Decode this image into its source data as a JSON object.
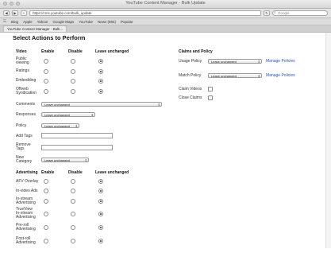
{
  "window": {
    "title": "YouTube Content Manager - Bulk Update",
    "url": "https://cms.youtube.com/bulk_update",
    "search_placeholder": "Google"
  },
  "bookmarks": [
    "Bing",
    "Apple",
    "Yahoo!",
    "Google Maps",
    "YouTube",
    "News (894)",
    "Popular"
  ],
  "tab": {
    "label": "YouTube Content Manager - Bulk..."
  },
  "page": {
    "heading": "Select Actions to Perform"
  },
  "video": {
    "headers": {
      "section": "Video",
      "enable": "Enable",
      "disable": "Disable",
      "unchanged": "Leave unchanged"
    },
    "rows": [
      {
        "label1": "Public",
        "label2": "viewing",
        "state": "unchanged"
      },
      {
        "label1": "Ratings",
        "label2": "",
        "state": "unchanged"
      },
      {
        "label1": "Embedding",
        "label2": "",
        "state": "unchanged"
      },
      {
        "label1": "Offweb",
        "label2": "Syndication",
        "state": "unchanged"
      }
    ]
  },
  "fields": {
    "comments": {
      "label": "Comments",
      "value": "Leave unchanged"
    },
    "responses": {
      "label": "Responses",
      "value": "Leave unchanged"
    },
    "policy": {
      "label": "Policy",
      "value": "Leave unchanged"
    },
    "add_tags": {
      "label": "Add Tags",
      "value": ""
    },
    "remove_tags": {
      "label1": "Remove",
      "label2": "Tags",
      "value": ""
    },
    "new_category": {
      "label1": "New",
      "label2": "Category",
      "value": "Leave unchanged"
    }
  },
  "claims": {
    "heading": "Claims and Policy",
    "usage_policy": {
      "label": "Usage Policy",
      "value": "Leave unchanged",
      "link": "Manage Policies"
    },
    "match_policy": {
      "label": "Match Policy",
      "value": "Leave unchanged",
      "link": "Manage Policies"
    },
    "claim_videos": {
      "label": "Claim Videos"
    },
    "close_claims": {
      "label": "Close Claims"
    }
  },
  "advertising": {
    "headers": {
      "section": "Advertising",
      "enable": "Enable",
      "disable": "Disable",
      "unchanged": "Leave unchanged"
    },
    "rows": [
      {
        "label1": "AFV Overlay",
        "label2": "",
        "state": "unchanged"
      },
      {
        "label1": "In-video Ads",
        "label2": "",
        "state": "unchanged"
      },
      {
        "label1": "In-stream",
        "label2": "Advertising",
        "state": "unchanged"
      },
      {
        "label1": "TrueView",
        "label2": "In-stream Advertising",
        "state": "unchanged"
      },
      {
        "label1": "Pre-roll",
        "label2": "Advertising",
        "state": "unchanged"
      },
      {
        "label1": "Post-roll",
        "label2": "Advertising",
        "state": "unchanged"
      }
    ]
  }
}
